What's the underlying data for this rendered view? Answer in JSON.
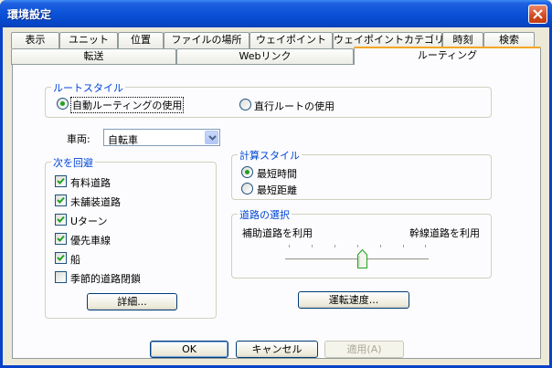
{
  "window": {
    "title": "環境設定"
  },
  "tabs_row1": [
    "表示",
    "ユニット",
    "位置",
    "ファイルの場所",
    "ウェイポイント",
    "ウェイポイントカテゴリ",
    "時刻",
    "検索"
  ],
  "tabs_row2": [
    "転送",
    "Webリンク",
    "ルーティング"
  ],
  "route_style": {
    "label": "ルートスタイル",
    "option1": "自動ルーティングの使用",
    "option2": "直行ルートの使用",
    "selected": "option1"
  },
  "vehicle": {
    "label": "車両:",
    "value": "自転車"
  },
  "calc_style": {
    "label": "計算スタイル",
    "option1": "最短時間",
    "option2": "最短距離",
    "selected": "option1"
  },
  "avoid": {
    "label": "次を回避",
    "items": [
      {
        "label": "有料道路",
        "checked": true
      },
      {
        "label": "未舗装道路",
        "checked": true
      },
      {
        "label": "Uターン",
        "checked": true
      },
      {
        "label": "優先車線",
        "checked": true
      },
      {
        "label": "船",
        "checked": true
      },
      {
        "label": "季節的道路閉鎖",
        "checked": false
      }
    ],
    "details_button": "詳細..."
  },
  "road_selection": {
    "label": "道路の選択",
    "left_label": "補助道路を利用",
    "right_label": "幹線道路を利用",
    "slider_level": 0.5
  },
  "speed_button": "運転速度...",
  "footer": {
    "ok": "OK",
    "cancel": "キャンセル",
    "apply": "適用(A)"
  }
}
